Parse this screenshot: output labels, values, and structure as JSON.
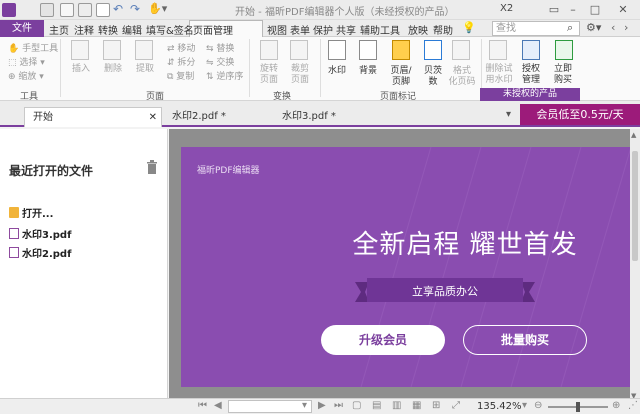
{
  "app": {
    "title": "开始 - 福昕PDF编辑器个人版（未经授权的产品）",
    "x2_label": "X2"
  },
  "menu": {
    "file": "文件",
    "items": [
      "主页",
      "注释",
      "转换",
      "编辑",
      "填写&签名",
      "页面管理",
      "视图",
      "表单",
      "保护",
      "共享",
      "辅助工具",
      "放映",
      "帮助"
    ],
    "active": "页面管理",
    "search_placeholder": "查找"
  },
  "ribbon": {
    "tools": {
      "hand": "手型工具",
      "select": "选择",
      "zoom": "缩放",
      "group": "工具"
    },
    "pages": {
      "insert": "插入",
      "delete": "删除",
      "extract": "提取",
      "move": "移动",
      "replace": "替换",
      "split": "拆分",
      "swap": "交换",
      "copy": "复制",
      "reverse": "逆序序",
      "group": "页面"
    },
    "transform": {
      "rotate": [
        "旋转",
        "页面"
      ],
      "crop": [
        "裁剪",
        "页面"
      ],
      "group": "变换"
    },
    "page_marks": {
      "watermark": "水印",
      "background": "背景",
      "header_footer": [
        "页眉/",
        "页脚"
      ],
      "bates": [
        "贝茨",
        "数"
      ],
      "format_page": [
        "格式",
        "化页码"
      ],
      "group": "页面标记"
    },
    "license": {
      "remove_trial": [
        "删除试",
        "用水印"
      ],
      "manage_license": [
        "授权",
        "管理"
      ],
      "buy_now": [
        "立即",
        "购买"
      ],
      "unauthorized": "未授权的产品"
    }
  },
  "tabs": [
    {
      "label": "开始",
      "active": true
    },
    {
      "label": "水印2.pdf *",
      "active": false
    },
    {
      "label": "水印3.pdf *",
      "active": false
    }
  ],
  "promo": "会员低至0.5元/天",
  "recent": {
    "title": "最近打开的文件",
    "open_label": "打开...",
    "files": [
      "水印3.pdf",
      "水印2.pdf"
    ]
  },
  "start_page": {
    "brand": "福昕PDF编辑器",
    "headline": "全新启程 耀世首发",
    "ribbon_text": "立享品质办公",
    "upgrade_button": "升级会员",
    "bulk_button": "批量购买"
  },
  "status": {
    "zoom": "135.42%"
  },
  "colors": {
    "accent": "#7b3f9e",
    "promo": "#9c1b7a",
    "banner_bg": "#8a4db0"
  }
}
